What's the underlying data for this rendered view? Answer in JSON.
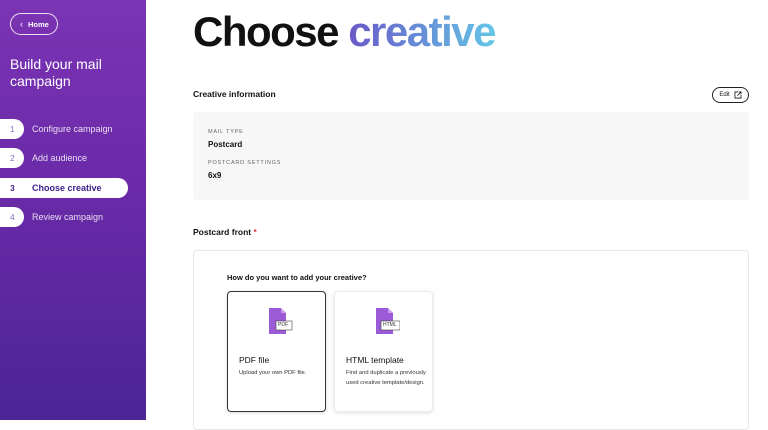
{
  "sidebar": {
    "home_label": "Home",
    "title": "Build your mail campaign",
    "steps": [
      {
        "num": "1",
        "label": "Configure campaign"
      },
      {
        "num": "2",
        "label": "Add audience"
      },
      {
        "num": "3",
        "label": "Choose creative"
      },
      {
        "num": "4",
        "label": "Review campaign"
      }
    ],
    "active_step": "3"
  },
  "main": {
    "title_plain": "Choose",
    "title_accent": "creative",
    "creative_info": {
      "heading": "Creative information",
      "edit_label": "Edit",
      "mail_type_label": "MAIL TYPE",
      "mail_type_value": "Postcard",
      "settings_label": "POSTCARD SETTINGS",
      "settings_value": "6x9"
    },
    "postcard_front": {
      "heading": "Postcard front",
      "required_mark": "*",
      "question": "How do you want to add your creative?",
      "options": [
        {
          "title": "PDF file",
          "description": "Upload your own PDF file.",
          "icon": "pdf-file-icon",
          "badge": "PDF",
          "selected": true
        },
        {
          "title": "HTML template",
          "description": "Find and duplicate a previously used creative template/design.",
          "icon": "html-file-icon",
          "badge": "HTML",
          "selected": false
        }
      ]
    }
  },
  "colors": {
    "sidebar_top": "#7b34b3",
    "sidebar_bottom": "#4c2596",
    "file_icon": "#9b5ad6",
    "required": "#d93a3a"
  }
}
